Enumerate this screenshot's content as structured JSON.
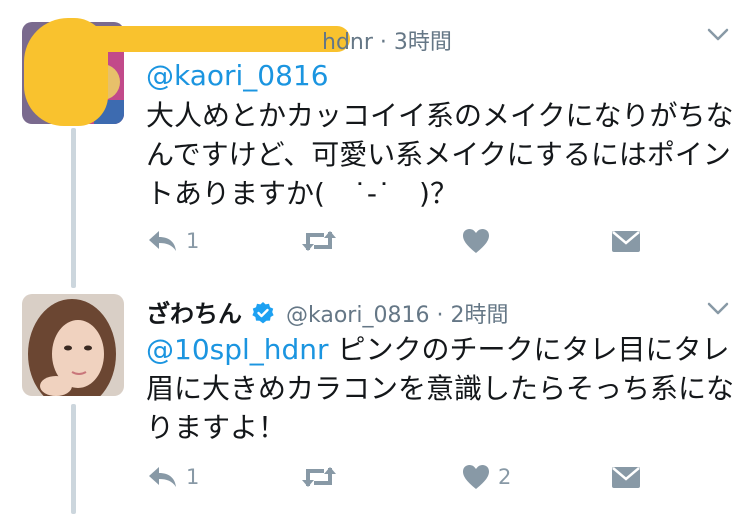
{
  "tweets": [
    {
      "display_name": "",
      "handle_partial": "hdnr",
      "separator": "·",
      "time": "3時間",
      "reply_to": "@kaori_0816",
      "text": "大人めとかカッコイイ系のメイクになりがちなんですけど、可愛い系メイクにするにはポイントありますか(　˙-˙　)？",
      "reply_count": "1",
      "retweet_count": "",
      "like_count": ""
    },
    {
      "display_name": "ざわちん",
      "handle": "@kaori_0816",
      "separator": "·",
      "time": "2時間",
      "reply_to": "@10spl_hdnr",
      "text": " ピンクのチークにタレ目にタレ眉に大きめカラコンを意識したらそっち系になりますよ！",
      "reply_count": "1",
      "retweet_count": "",
      "like_count": "2"
    }
  ],
  "colors": {
    "accent": "#1b95e0",
    "icon_gray": "#8899a6",
    "meta_gray": "#657786",
    "thread_line": "#ccd6dd",
    "redaction": "#f9c22e",
    "verified": "#1da1f2"
  },
  "icons": [
    "reply-icon",
    "retweet-icon",
    "like-icon",
    "dm-icon",
    "chevron-down-icon",
    "verified-icon"
  ]
}
